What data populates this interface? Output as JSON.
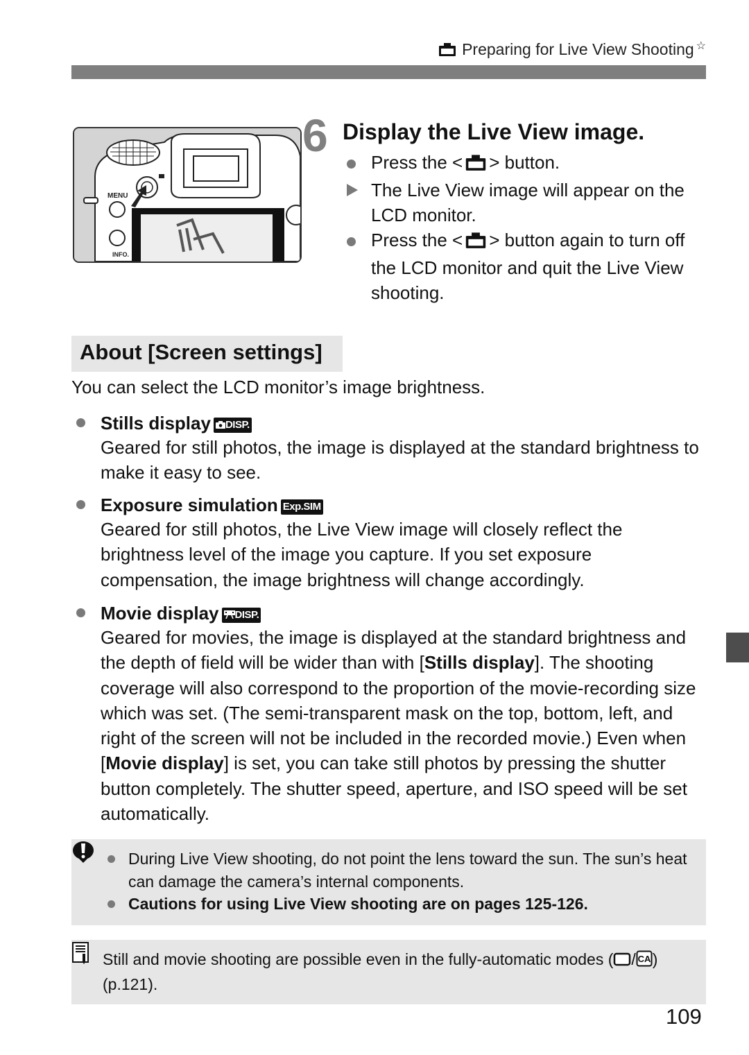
{
  "header": {
    "section_icon": "camera-icon",
    "title": "Preparing for Live View Shooting",
    "mark": "☆"
  },
  "illustration": {
    "alt": "Camera back showing Live View button being pressed with LCD monitor displaying a chair",
    "labels": {
      "menu": "MENU",
      "info": "INFO."
    }
  },
  "step": {
    "number": "6",
    "title": "Display the Live View image.",
    "items": [
      {
        "type": "bullet",
        "before": "Press the <",
        "icon": "camera-icon",
        "after": "> button."
      },
      {
        "type": "result",
        "text": "The Live View image will appear on the LCD monitor."
      },
      {
        "type": "bullet",
        "before": "Press the <",
        "icon": "camera-icon",
        "after": "> button again to turn off the LCD monitor and quit the Live View shooting."
      }
    ]
  },
  "section": {
    "heading": "About [Screen settings]",
    "intro": "You can select the LCD monitor’s image brightness.",
    "options": [
      {
        "title": "Stills display",
        "badge": "◘DISP.",
        "badge_icon": "stills-display-icon",
        "body": "Geared for still photos, the image is displayed at the standard brightness to make it easy to see."
      },
      {
        "title": "Exposure simulation",
        "badge": "Exp.SIM",
        "badge_icon": "exposure-simulation-icon",
        "body": "Geared for still photos, the Live View image will closely reflect the brightness level of the image you capture. If you set exposure compensation, the image brightness will change accordingly."
      },
      {
        "title": "Movie display",
        "badge": "DISP.",
        "badge_icon": "movie-display-icon",
        "body_parts": [
          {
            "text": "Geared for movies, the image is displayed at the standard brightness and the depth of field will be wider than with [",
            "bold": false
          },
          {
            "text": "Stills display",
            "bold": true
          },
          {
            "text": "]. The shooting coverage will also correspond to the proportion of the movie-recording size which was set. (The semi-transparent mask on the top, bottom, left, and right of the screen will not be included in the recorded movie.) Even when [",
            "bold": false
          },
          {
            "text": "Movie display",
            "bold": true
          },
          {
            "text": "] is set, you can take still photos by pressing the shutter button completely. The shutter speed, aperture, and ISO speed will be set automatically.",
            "bold": false
          }
        ]
      }
    ]
  },
  "caution": {
    "icon": "caution-icon",
    "items": [
      {
        "text": "During Live View shooting, do not point the lens toward the sun. The sun’s heat can damage the camera’s internal components.",
        "bold": false
      },
      {
        "text": "Cautions for using Live View shooting are on pages 125-126.",
        "bold": true
      }
    ]
  },
  "note": {
    "icon": "memo-icon",
    "text_before": "Still and movie shooting are possible even in the fully-automatic modes (",
    "mode_icons": [
      "full-auto-icon",
      "creative-auto-icon"
    ],
    "separator": "/",
    "creative_auto_label": "CA",
    "text_after": ") (p.121)."
  },
  "page": {
    "number": "109"
  },
  "colors": {
    "header_bar": "#7f7f7f",
    "box_bg": "#e6e6e6",
    "bullet": "#7a7a7a",
    "step_number": "#808080",
    "side_tab": "#4d4d4d"
  }
}
